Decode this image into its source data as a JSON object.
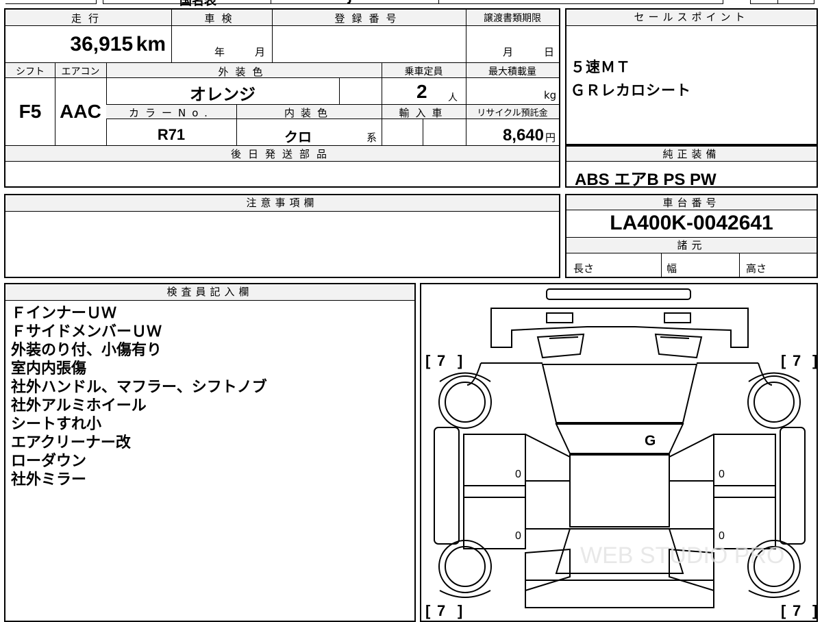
{
  "top_strip": {
    "fragment_1": "国名表",
    "fragment_2": "J"
  },
  "main_form": {
    "mileage_label": "走行",
    "mileage_value": "36,915",
    "mileage_unit": "km",
    "inspection_label": "車検",
    "inspection_year_unit": "年",
    "inspection_month_unit": "月",
    "registration_label": "登録番号",
    "transfer_deadline_label": "譲渡書類期限",
    "transfer_month_unit": "月",
    "transfer_day_unit": "日",
    "shift_label": "シフト",
    "shift_value": "F5",
    "aircon_label": "エアコン",
    "aircon_value": "AAC",
    "exterior_color_label": "外装色",
    "exterior_color_value": "オレンジ",
    "capacity_label": "乗車定員",
    "capacity_value": "2",
    "capacity_unit": "人",
    "max_load_label": "最大積載量",
    "max_load_unit": "kg",
    "color_no_label": "カラーNo.",
    "color_no_value": "R71",
    "interior_color_label": "内装色",
    "interior_color_value": "クロ",
    "interior_color_suffix": "系",
    "import_label": "輸入車",
    "recycle_label": "リサイクル預託金",
    "recycle_value": "8,640",
    "recycle_unit": "円",
    "later_parts_label": "後日発送部品"
  },
  "sales_point": {
    "title": "セールスポイント",
    "lines": [
      "５速ＭＴ",
      "ＧＲレカロシート"
    ]
  },
  "standard_equipment": {
    "title": "純正装備",
    "value": "ABS エアB PS PW"
  },
  "notes": {
    "title": "注意事項欄"
  },
  "chassis": {
    "title": "車台番号",
    "value": "LA400K-0042641",
    "specs_title": "諸元",
    "length_label": "長さ",
    "width_label": "幅",
    "height_label": "高さ"
  },
  "inspector": {
    "title": "検査員記入欄",
    "lines": [
      "ＦインナーＵＷ",
      "ＦサイドメンバーＵＷ",
      "外装のり付、小傷有り",
      "室内内張傷",
      "社外ハンドル、マフラー、シフトノブ",
      "社外アルミホイール",
      "シートすれ小",
      "エアクリーナー改",
      "ローダウン",
      "社外ミラー"
    ]
  },
  "diagram": {
    "tire_fl": "7",
    "tire_fr": "7",
    "tire_rl": "7",
    "tire_rr": "7",
    "windshield_mark": "G",
    "door_fl": "0",
    "door_fr": "0",
    "door_rl": "0",
    "door_rr": "0",
    "watermark": "WEB STUDIO PRO"
  }
}
